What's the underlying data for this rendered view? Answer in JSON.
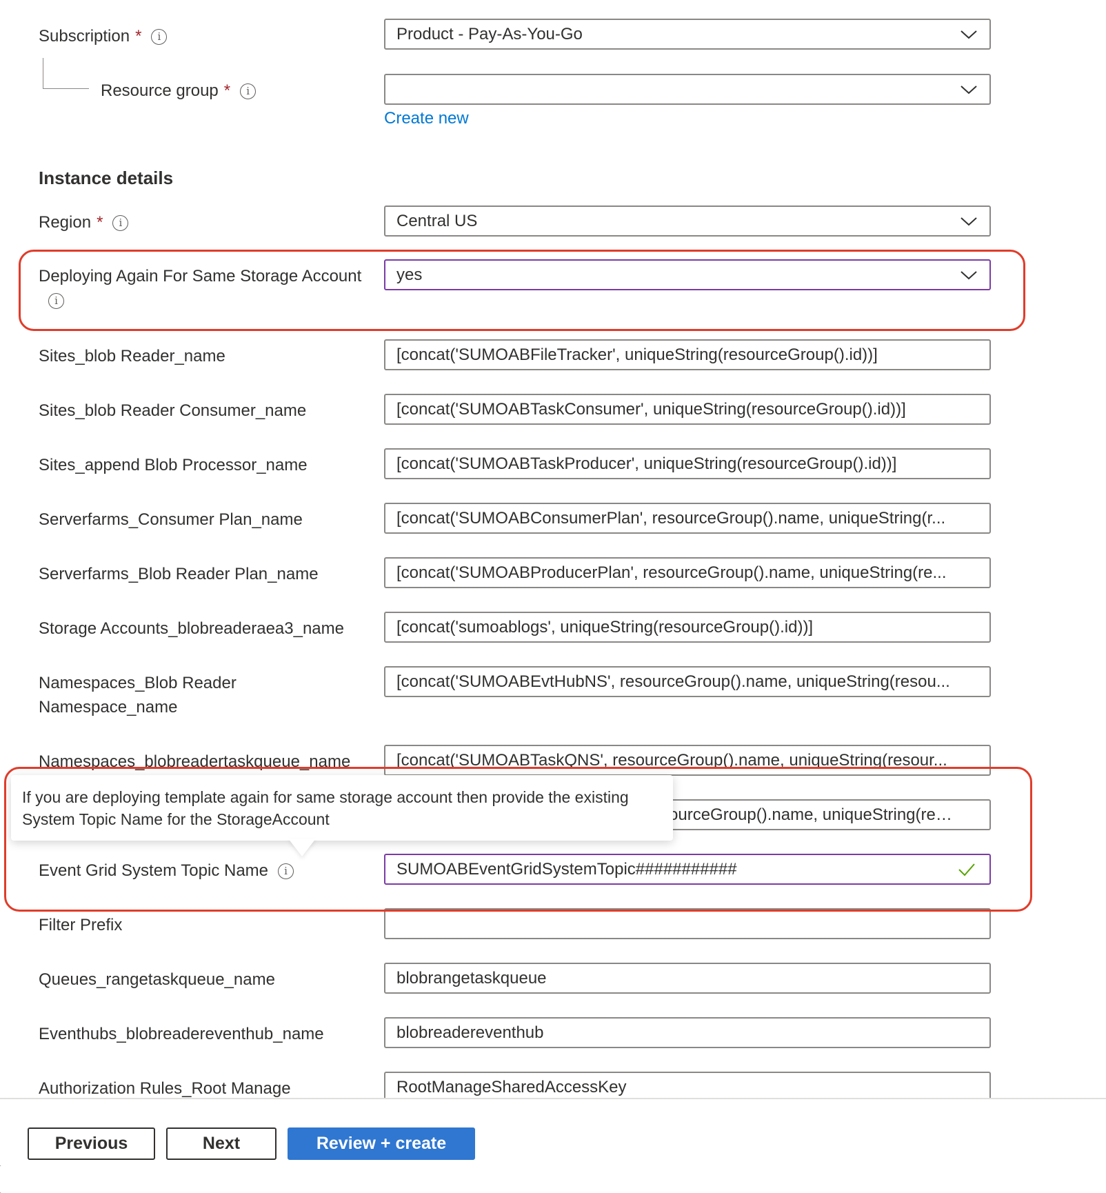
{
  "basics": {
    "subscription": {
      "label": "Subscription",
      "required_mark": "*",
      "value": "Product - Pay-As-You-Go"
    },
    "resource_group": {
      "label": "Resource group",
      "required_mark": "*",
      "value": "",
      "create_new_link": "Create new"
    }
  },
  "instance_details": {
    "heading": "Instance details",
    "region": {
      "label": "Region",
      "required_mark": "*",
      "value": "Central US"
    },
    "deploying_again": {
      "label": "Deploying Again For Same Storage Account",
      "value": "yes"
    },
    "fields": [
      {
        "label": "Sites_blob Reader_name",
        "value": "[concat('SUMOABFileTracker', uniqueString(resourceGroup().id))]"
      },
      {
        "label": "Sites_blob Reader Consumer_name",
        "value": "[concat('SUMOABTaskConsumer', uniqueString(resourceGroup().id))]"
      },
      {
        "label": "Sites_append Blob Processor_name",
        "value": "[concat('SUMOABTaskProducer', uniqueString(resourceGroup().id))]"
      },
      {
        "label": "Serverfarms_Consumer Plan_name",
        "value": "[concat('SUMOABConsumerPlan', resourceGroup().name, uniqueString(r..."
      },
      {
        "label": "Serverfarms_Blob Reader Plan_name",
        "value": "[concat('SUMOABProducerPlan', resourceGroup().name, uniqueString(re..."
      },
      {
        "label": "Storage Accounts_blobreaderaea3_name",
        "value": "[concat('sumoablogs', uniqueString(resourceGroup().id))]"
      },
      {
        "label": "Namespaces_Blob Reader Namespace_name",
        "value": "[concat('SUMOABEvtHubNS', resourceGroup().name, uniqueString(resou..."
      },
      {
        "label": "Namespaces_blobreadertaskqueue_name",
        "value": "[concat('SUMOABTaskQNS', resourceGroup().name, uniqueString(resour..."
      },
      {
        "label": "",
        "value": "ourceGroup().name, uniqueString(res..."
      }
    ],
    "event_grid_topic": {
      "label": "Event Grid System Topic Name",
      "value": "SUMOABEventGridSystemTopic###########"
    },
    "tooltip": "If you are deploying template again for same storage account then provide the existing System Topic Name for the StorageAccount",
    "more_fields": [
      {
        "label": "Filter Prefix",
        "value": ""
      },
      {
        "label": "Queues_rangetaskqueue_name",
        "value": "blobrangetaskqueue"
      },
      {
        "label": "Eventhubs_blobreadereventhub_name",
        "value": "blobreadereventhub"
      },
      {
        "label": "Authorization Rules_Root Manage",
        "value": "RootManageSharedAccessKey"
      }
    ]
  },
  "footer": {
    "previous": "Previous",
    "next": "Next",
    "review_create": "Review + create"
  },
  "icons": {
    "info": "i"
  },
  "colors": {
    "highlight": "#e03c2a",
    "focus_border": "#7a3ba5",
    "link": "#0078d4",
    "primary_button": "#2f77d1",
    "required": "#a4262c",
    "valid_check": "#57a300"
  }
}
